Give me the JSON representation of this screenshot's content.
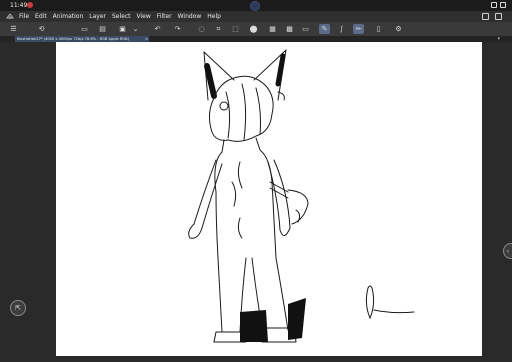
{
  "status_bar": {
    "time": "11:49"
  },
  "menu": {
    "items": [
      "File",
      "Edit",
      "Animation",
      "Layer",
      "Select",
      "View",
      "Filter",
      "Window",
      "Help"
    ]
  },
  "command_bar": {
    "tools": [
      {
        "name": "menu-icon",
        "glyph": "☰"
      },
      {
        "name": "rotate-icon",
        "glyph": "⟲"
      },
      {
        "name": "new-file-icon",
        "glyph": "▭"
      },
      {
        "name": "open-folder-icon",
        "glyph": "▤"
      },
      {
        "name": "save-icon",
        "glyph": "▣"
      },
      {
        "name": "chevron-down-icon",
        "glyph": "⌄"
      },
      {
        "name": "undo-icon",
        "glyph": "↶"
      },
      {
        "name": "redo-icon",
        "glyph": "↷"
      },
      {
        "name": "clear-icon",
        "glyph": "◌"
      },
      {
        "name": "crop-icon",
        "glyph": "⌗"
      },
      {
        "name": "transform-icon",
        "glyph": "⬚"
      },
      {
        "name": "fill-icon",
        "glyph": "⬤"
      },
      {
        "name": "mesh-icon",
        "glyph": "▦"
      },
      {
        "name": "grid-icon",
        "glyph": "▩"
      },
      {
        "name": "ruler-icon",
        "glyph": "▭"
      },
      {
        "name": "pen-active-icon",
        "glyph": "✎",
        "active": true
      },
      {
        "name": "brush-icon",
        "glyph": "∫"
      },
      {
        "name": "pencil-active-icon",
        "glyph": "✏",
        "active": true
      },
      {
        "name": "phone-icon",
        "glyph": "▯"
      },
      {
        "name": "tool-icon",
        "glyph": "⚙"
      }
    ]
  },
  "document_tab": {
    "title": "Illustration27* (4000 x 4000px 72dpi 78.6% - RGB Apple RGB)",
    "close": "×"
  },
  "workspace": {
    "left_button": "⇱",
    "right_handle": "‹"
  },
  "colors": {
    "canvas": "#ffffff",
    "workspace": "#2a2a2a",
    "active_tool": "#5a6c8a",
    "record_dot": "#d2383a"
  }
}
